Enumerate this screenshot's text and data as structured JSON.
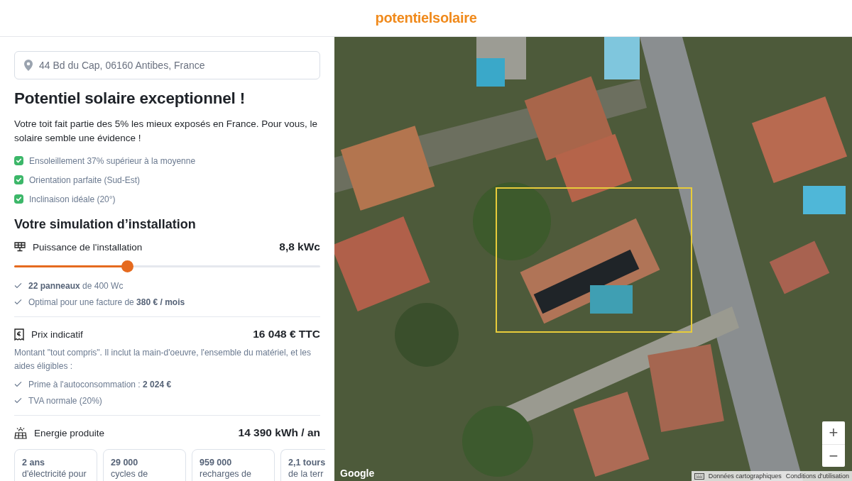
{
  "header": {
    "logo": "potentielsolaire"
  },
  "address_field": {
    "value": "44 Bd du Cap, 06160 Antibes, France"
  },
  "headline": "Potentiel solaire exceptionnel !",
  "intro": "Votre toit fait partie des 5% les mieux exposés en France. Pour vous, le solaire semble une évidence !",
  "highlights": [
    {
      "text": "Ensoleillement 37% supérieur à la moyenne",
      "checked": true
    },
    {
      "text": "Orientation parfaite (Sud-Est)",
      "checked": true
    },
    {
      "text": "Inclinaison idéale (20°)",
      "checked": true
    }
  ],
  "simulation": {
    "title": "Votre simulation d’installation",
    "power": {
      "label": "Puissance de l'installation",
      "value": "8,8 kWc",
      "level": 0.37,
      "notes": [
        "**22 panneaux** de 400 Wc",
        "Optimal pour une facture de **380 € / mois**"
      ]
    },
    "price": {
      "label": "Prix indicatif",
      "value": "16 048 € TTC",
      "description": "Montant \"tout compris\". Il inclut la main-d'oeuvre, l'ensemble du matériel, et les aides éligibles :",
      "notes": [
        "Prime à l'autoconsommation : **2 024 €**",
        "TVA normale (20%)"
      ]
    },
    "energy": {
      "label": "Energie produite",
      "value": "14 390 kWh / an",
      "cards": [
        {
          "value": "2 ans",
          "text": "d'électricité pour"
        },
        {
          "value": "29 000",
          "text": "cycles de"
        },
        {
          "value": "959 000",
          "text": "recharges de"
        },
        {
          "value": "2,1 tours",
          "text": "de la terr"
        }
      ]
    }
  },
  "map": {
    "zoom_in": "+",
    "zoom_out": "−",
    "brand": "Google",
    "attribution": [
      "Données cartographiques",
      "Conditions d'utilisation"
    ]
  }
}
